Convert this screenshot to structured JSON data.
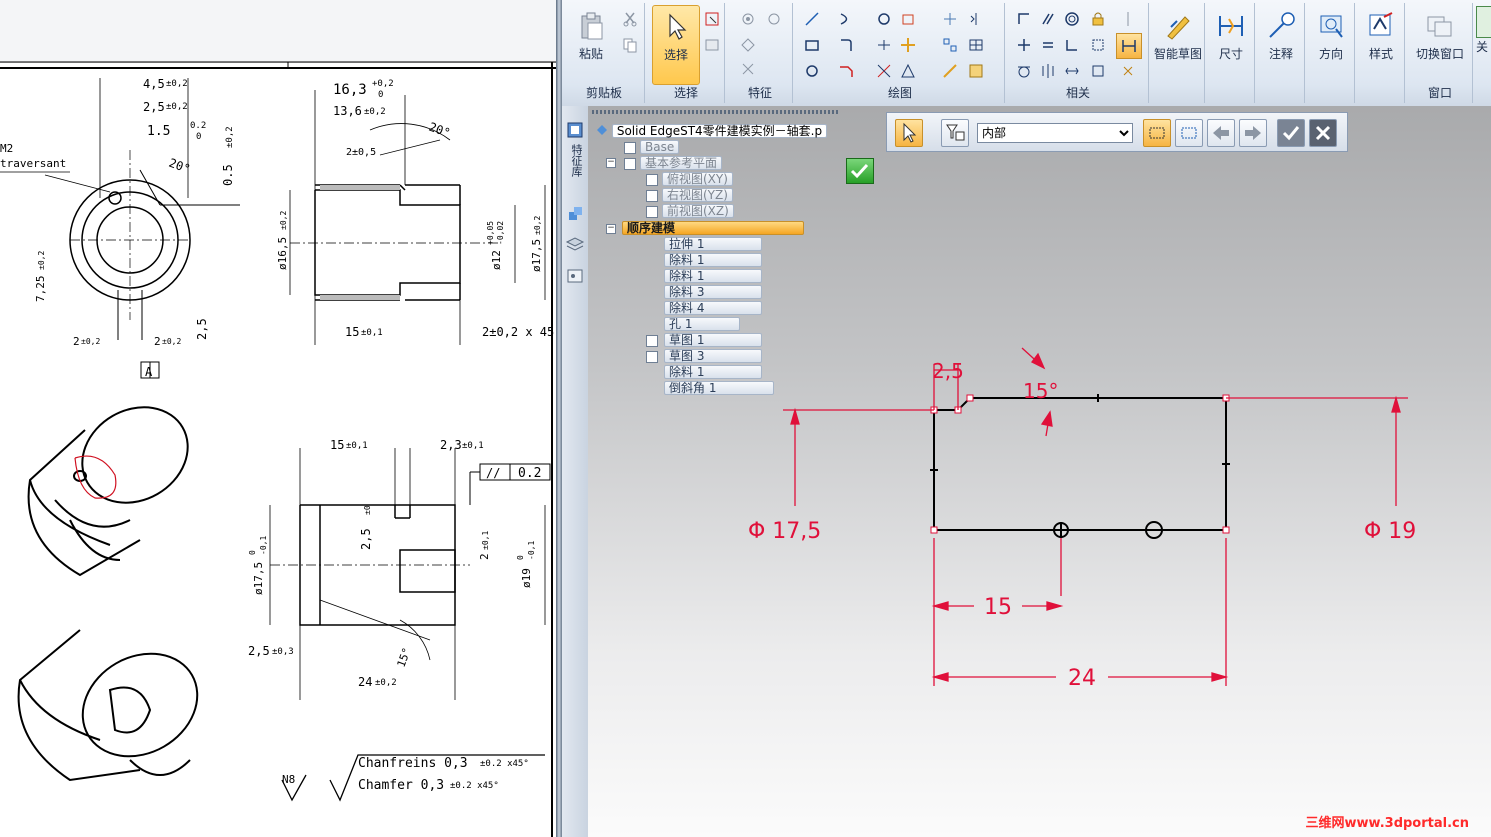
{
  "drawing": {
    "dims": {
      "d45": "4,5",
      "d45tol": "±0,2",
      "d25": "2,5",
      "d25tol": "±0,2",
      "d15": "1.5",
      "d15tol": "0.2",
      "d15tol0": "0",
      "d05": "0.5",
      "d05tol": "±0,2",
      "d725": "7,25",
      "d725tol": "±0,2",
      "d20deg": "20°",
      "d2a": "2",
      "d2atol": "±0,2",
      "d2b": "2",
      "d2btol": "±0,2",
      "d25b": "2,5",
      "datumA": "A",
      "m2": "M2",
      "traversant": "traversant",
      "t163": "16,3",
      "t163tol": "+0,2",
      "t163tol0": "0",
      "t136": "13,6",
      "t136tol": "±0,2",
      "t20deg": "20°",
      "t2x05": "2±0,5",
      "t165": "ø16,5",
      "t165tol": "±0,2",
      "t12": "ø12",
      "t12tol": "+0,05",
      "t12tol2": "-0,02",
      "t175": "ø17,5",
      "t175tol": "±0,2",
      "t15": "15",
      "t15tol": "±0,1",
      "t2x45": "2±0,2 x 45°",
      "b15": "15",
      "b15tol": "±0,1",
      "b23": "2,3",
      "b23tol": "±0,1",
      "bpar": "//",
      "b02": "0.2",
      "b25v": "2,5",
      "b25vtol": "±0",
      "b2v": "2",
      "b2vtol": "±0,1",
      "b175": "ø17,5",
      "b175tol": "0",
      "b175tol2": "-0,1",
      "b19": "ø19",
      "b19tol": "0",
      "b19tol2": "-0,1",
      "b25h": "2,5",
      "b25htol": "±0,3",
      "b24": "24",
      "b24tol": "±0,2",
      "b15deg": "15°",
      "chamfreins": "Chanfreins 0,3",
      "chamfreinstol": "±0.2  x45°",
      "chamfer": "Chamfer 0,3",
      "chamfertol": "±0.2  x45°",
      "n8": "N8"
    }
  },
  "ribbon": {
    "groups": [
      {
        "label": "剪贴板"
      },
      {
        "label": "选择"
      },
      {
        "label": "特征"
      },
      {
        "label": "绘图"
      },
      {
        "label": "相关"
      }
    ],
    "buttons": {
      "paste": "粘贴",
      "select": "选择",
      "smart_dim": "智能草图",
      "dimension": "尺寸",
      "annotation": "注释",
      "orientation": "方向",
      "style": "样式",
      "switch_window": "切换窗口",
      "window_group": "窗口",
      "close": "关"
    }
  },
  "tree": {
    "root": "Solid EdgeST4零件建模实例－轴套.p",
    "items": [
      {
        "label": "Base"
      },
      {
        "label": "基本参考平面"
      },
      {
        "label": "俯视图(XY)"
      },
      {
        "label": "右视图(YZ)"
      },
      {
        "label": "前视图(XZ)"
      },
      {
        "label": "顺序建模"
      },
      {
        "label": "拉伸 1"
      },
      {
        "label": "除料 1"
      },
      {
        "label": "除料 1"
      },
      {
        "label": "除料 3"
      },
      {
        "label": "除料 4"
      },
      {
        "label": "孔 1"
      },
      {
        "label": "草图 1"
      },
      {
        "label": "草图 3"
      },
      {
        "label": "除料 1"
      },
      {
        "label": "倒斜角 1"
      }
    ]
  },
  "left_tabs": {
    "pathfinder": "特征库"
  },
  "cmdbar": {
    "filter_value": "内部"
  },
  "sketch": {
    "dim_25": "2,5",
    "dim_15deg": "15°",
    "dim_175": "Φ 17,5",
    "dim_19": "Φ 19",
    "dim_15": "15",
    "dim_24": "24"
  },
  "watermark": "三维网www.3dportal.cn",
  "colors": {
    "dim": "#e0103a",
    "accent": "#ffc84d"
  }
}
